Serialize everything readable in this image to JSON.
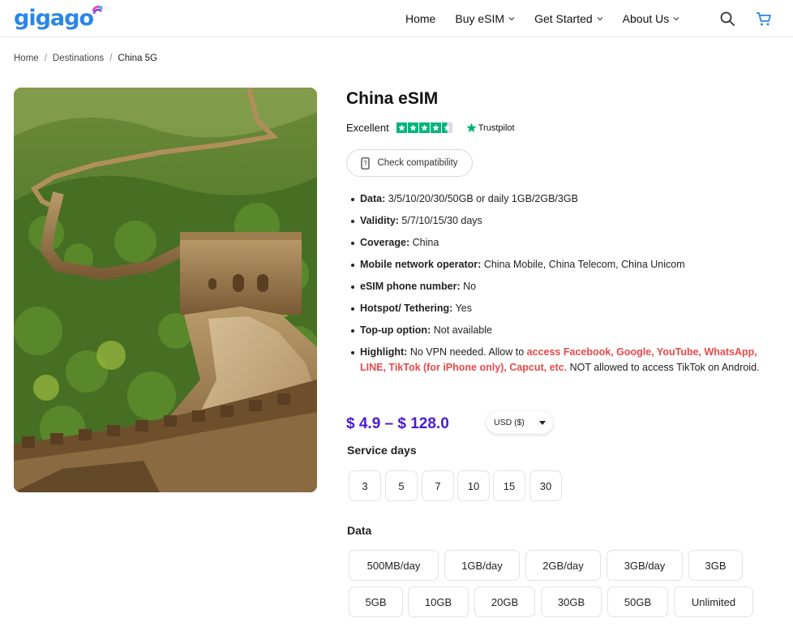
{
  "brand": {
    "logo_text": "gigago",
    "accent": "#2a86e6",
    "badge_colors": [
      "#e94fb6",
      "#7b3ff2",
      "#35c6e8"
    ]
  },
  "nav": {
    "items": [
      {
        "label": "Home",
        "has_dropdown": false
      },
      {
        "label": "Buy eSIM",
        "has_dropdown": true
      },
      {
        "label": "Get Started",
        "has_dropdown": true
      },
      {
        "label": "About Us",
        "has_dropdown": true
      }
    ],
    "icons": [
      "search-icon",
      "cart-icon"
    ]
  },
  "breadcrumb": {
    "items": [
      "Home",
      "Destinations",
      "China 5G"
    ],
    "separator": "/"
  },
  "product": {
    "title": "China eSIM",
    "rating_label": "Excellent",
    "rating_stars": 4.5,
    "rating_source": "Trustpilot",
    "compat_label": "Check compatibility",
    "specs": [
      {
        "key": "Data:",
        "value": "3/5/10/20/30/50GB or daily 1GB/2GB/3GB"
      },
      {
        "key": "Validity:",
        "value": "5/7/10/15/30 days"
      },
      {
        "key": "Coverage:",
        "value": "China"
      },
      {
        "key": "Mobile network operator:",
        "value": "China Mobile, China Telecom, China Unicom"
      },
      {
        "key": "eSIM phone number:",
        "value": "No"
      },
      {
        "key": "Hotspot/ Tethering:",
        "value": "Yes"
      },
      {
        "key": "Top-up option:",
        "value": "Not available"
      }
    ],
    "highlight": {
      "key": "Highlight:",
      "pre": "No VPN needed. Allow to",
      "emph": "access Facebook, Google, YouTube, WhatsApp, LINE, TikTok (for iPhone only), Capcut, etc",
      "post": ". NOT allowed to access TikTok on Android."
    },
    "price": "$ 4.9 – $ 128.0",
    "price_color": "#4a1ad6",
    "currency": "USD ($)",
    "service_days_label": "Service days",
    "service_days": [
      "3",
      "5",
      "7",
      "10",
      "15",
      "30"
    ],
    "data_label": "Data",
    "data_options": [
      "500MB/day",
      "1GB/day",
      "2GB/day",
      "3GB/day",
      "3GB",
      "5GB",
      "10GB",
      "20GB",
      "30GB",
      "50GB",
      "Unlimited"
    ]
  }
}
